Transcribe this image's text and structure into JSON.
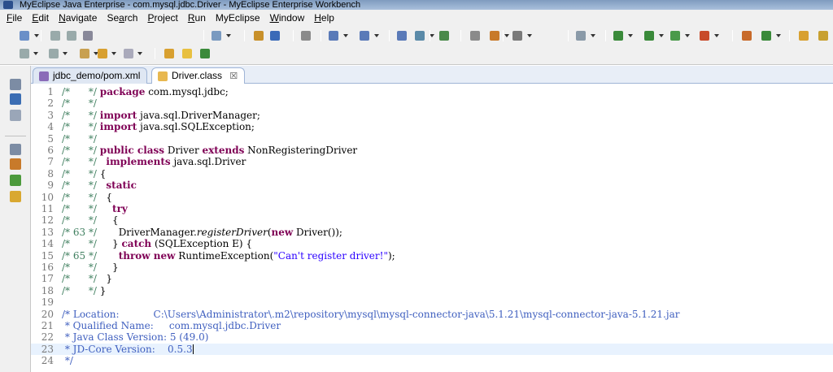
{
  "window": {
    "title": "MyEclipse Java Enterprise - com.mysql.jdbc.Driver - MyEclipse Enterprise Workbench"
  },
  "menu": {
    "items": [
      {
        "label": "File",
        "mnemonic": "F",
        "rest": "ile"
      },
      {
        "label": "Edit",
        "mnemonic": "E",
        "rest": "dit"
      },
      {
        "label": "Navigate",
        "mnemonic": "N",
        "rest": "avigate"
      },
      {
        "label": "Search",
        "mnemonic": "a",
        "pre": "Se",
        "rest": "rch"
      },
      {
        "label": "Project",
        "mnemonic": "P",
        "rest": "roject"
      },
      {
        "label": "Run",
        "mnemonic": "R",
        "rest": "un"
      },
      {
        "label": "MyEclipse",
        "mnemonic": "",
        "rest": "MyEclipse"
      },
      {
        "label": "Window",
        "mnemonic": "W",
        "rest": "indow"
      },
      {
        "label": "Help",
        "mnemonic": "H",
        "rest": "elp"
      }
    ]
  },
  "tabs": [
    {
      "label": "jdbc_demo/pom.xml",
      "active": false,
      "icon": "xml-file-icon"
    },
    {
      "label": "Driver.class",
      "active": true,
      "icon": "class-file-icon",
      "close": "☒"
    }
  ],
  "editor": {
    "lines": [
      {
        "n": "1",
        "prefix": "/*      */ ",
        "parts": [
          [
            "kw",
            "package"
          ],
          [
            "t",
            " com.mysql.jdbc;"
          ]
        ]
      },
      {
        "n": "2",
        "prefix": "/*      */",
        "parts": []
      },
      {
        "n": "3",
        "prefix": "/*      */ ",
        "parts": [
          [
            "kw",
            "import"
          ],
          [
            "t",
            " java.sql.DriverManager;"
          ]
        ]
      },
      {
        "n": "4",
        "prefix": "/*      */ ",
        "parts": [
          [
            "kw",
            "import"
          ],
          [
            "t",
            " java.sql.SQLException;"
          ]
        ]
      },
      {
        "n": "5",
        "prefix": "/*      */",
        "parts": []
      },
      {
        "n": "6",
        "prefix": "/*      */ ",
        "parts": [
          [
            "kw",
            "public class"
          ],
          [
            "t",
            " Driver "
          ],
          [
            "kw",
            "extends"
          ],
          [
            "t",
            " NonRegisteringDriver"
          ]
        ]
      },
      {
        "n": "7",
        "prefix": "/*      */   ",
        "parts": [
          [
            "kw",
            "implements"
          ],
          [
            "t",
            " java.sql.Driver"
          ]
        ]
      },
      {
        "n": "8",
        "prefix": "/*      */ ",
        "parts": [
          [
            "t",
            "{"
          ]
        ]
      },
      {
        "n": "9",
        "prefix": "/*      */   ",
        "parts": [
          [
            "kw",
            "static"
          ]
        ]
      },
      {
        "n": "10",
        "prefix": "/*      */   ",
        "parts": [
          [
            "t",
            "{"
          ]
        ]
      },
      {
        "n": "11",
        "prefix": "/*      */     ",
        "parts": [
          [
            "kw",
            "try"
          ]
        ]
      },
      {
        "n": "12",
        "prefix": "/*      */     ",
        "parts": [
          [
            "t",
            "{"
          ]
        ]
      },
      {
        "n": "13",
        "prefix": "/* 63 */       ",
        "parts": [
          [
            "t",
            "DriverManager."
          ],
          [
            "itl",
            "registerDriver"
          ],
          [
            "t",
            "("
          ],
          [
            "kw",
            "new"
          ],
          [
            "t",
            " Driver());"
          ]
        ]
      },
      {
        "n": "14",
        "prefix": "/*      */     ",
        "parts": [
          [
            "t",
            "} "
          ],
          [
            "kw",
            "catch"
          ],
          [
            "t",
            " (SQLException E) {"
          ]
        ]
      },
      {
        "n": "15",
        "prefix": "/* 65 */       ",
        "parts": [
          [
            "kw",
            "throw new"
          ],
          [
            "t",
            " RuntimeException("
          ],
          [
            "str",
            "\"Can't register driver!\""
          ],
          [
            "t",
            ");"
          ]
        ]
      },
      {
        "n": "16",
        "prefix": "/*      */     ",
        "parts": [
          [
            "t",
            "}"
          ]
        ]
      },
      {
        "n": "17",
        "prefix": "/*      */   ",
        "parts": [
          [
            "t",
            "}"
          ]
        ]
      },
      {
        "n": "18",
        "prefix": "/*      */ ",
        "parts": [
          [
            "t",
            "}"
          ]
        ]
      },
      {
        "n": "19",
        "prefix": "",
        "parts": []
      },
      {
        "n": "20",
        "prefix": "",
        "parts": [
          [
            "jdoc",
            "/* Location:           C:\\Users\\Administrator\\.m2\\repository\\mysql\\mysql-connector-java\\5.1.21\\mysql-connector-java-5.1.21.jar"
          ]
        ]
      },
      {
        "n": "21",
        "prefix": "",
        "parts": [
          [
            "jdoc",
            " * Qualified Name:     com.mysql.jdbc.Driver"
          ]
        ]
      },
      {
        "n": "22",
        "prefix": "",
        "parts": [
          [
            "jdoc",
            " * Java Class Version: 5 (49.0)"
          ]
        ]
      },
      {
        "n": "23",
        "prefix": "",
        "parts": [
          [
            "jdoc",
            " * JD-Core Version:    0.5.3"
          ]
        ],
        "current": true,
        "cursor": true
      },
      {
        "n": "24",
        "prefix": "",
        "parts": [
          [
            "jdoc",
            " */"
          ]
        ]
      }
    ]
  },
  "toolbar": {
    "row1_icons": [
      "new-icon",
      "save-icon",
      "save-all-icon",
      "print-icon",
      "new-web-project-icon",
      "open-type-icon",
      "open-resource-icon",
      "server-icon",
      "deploy-icon",
      "browser-icon",
      "search-icon",
      "debug-icon",
      "run-icon",
      "run-external-icon",
      "coverage-icon",
      "perspective-icon",
      "open-perspective-icon"
    ],
    "row2_icons": [
      "next-annotation-icon",
      "prev-annotation-icon",
      "last-edit-icon",
      "back-icon",
      "forward-icon",
      "folder-icon",
      "bulb-icon",
      "bug-icon"
    ]
  },
  "colors": {
    "keyword": "#7f0055",
    "comment": "#3f7f5f",
    "javadoc": "#3f5fbf",
    "string": "#2a00ff",
    "current_line": "#e8f2fe"
  }
}
